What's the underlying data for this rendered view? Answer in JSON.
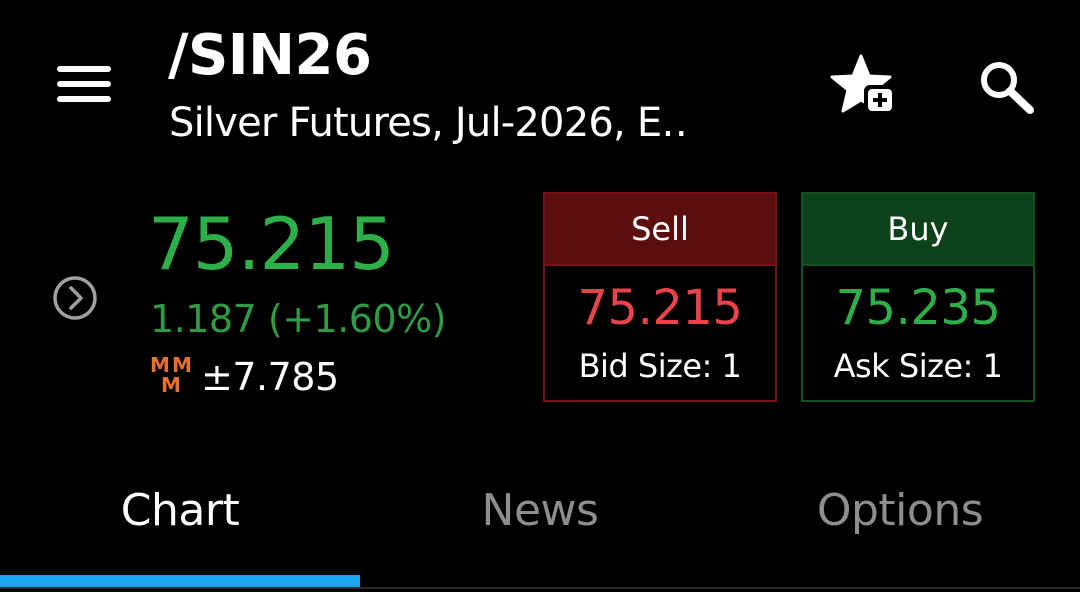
{
  "header": {
    "menu_icon": "hamburger-menu-icon",
    "symbol": "/SIN26",
    "description": "Silver Futures, Jul-2026, E…",
    "watchlist_icon": "star-plus-icon",
    "search_icon": "search-icon"
  },
  "quote": {
    "expand_icon": "chevron-right-circle-icon",
    "last_price": "75.215",
    "change": "1.187 (+1.60%)",
    "mm_icon": "market-maker-move-icon",
    "mm_icon_letters": "MMM",
    "mm_value": "±7.785"
  },
  "sell": {
    "label": "Sell",
    "price": "75.215",
    "size_text": "Bid Size: 1"
  },
  "buy": {
    "label": "Buy",
    "price": "75.235",
    "size_text": "Ask Size: 1"
  },
  "tabs": [
    {
      "label": "Chart",
      "active": true
    },
    {
      "label": "News",
      "active": false
    },
    {
      "label": "Options",
      "active": false
    }
  ],
  "colors": {
    "background": "#000000",
    "positive": "#2db04a",
    "negative": "#e8424a",
    "sell_header": "#5c0e0e",
    "buy_header": "#0d4119",
    "accent_tab": "#1aa6ee",
    "mm_orange": "#e8702e",
    "inactive_tab": "#8e8e8e"
  }
}
